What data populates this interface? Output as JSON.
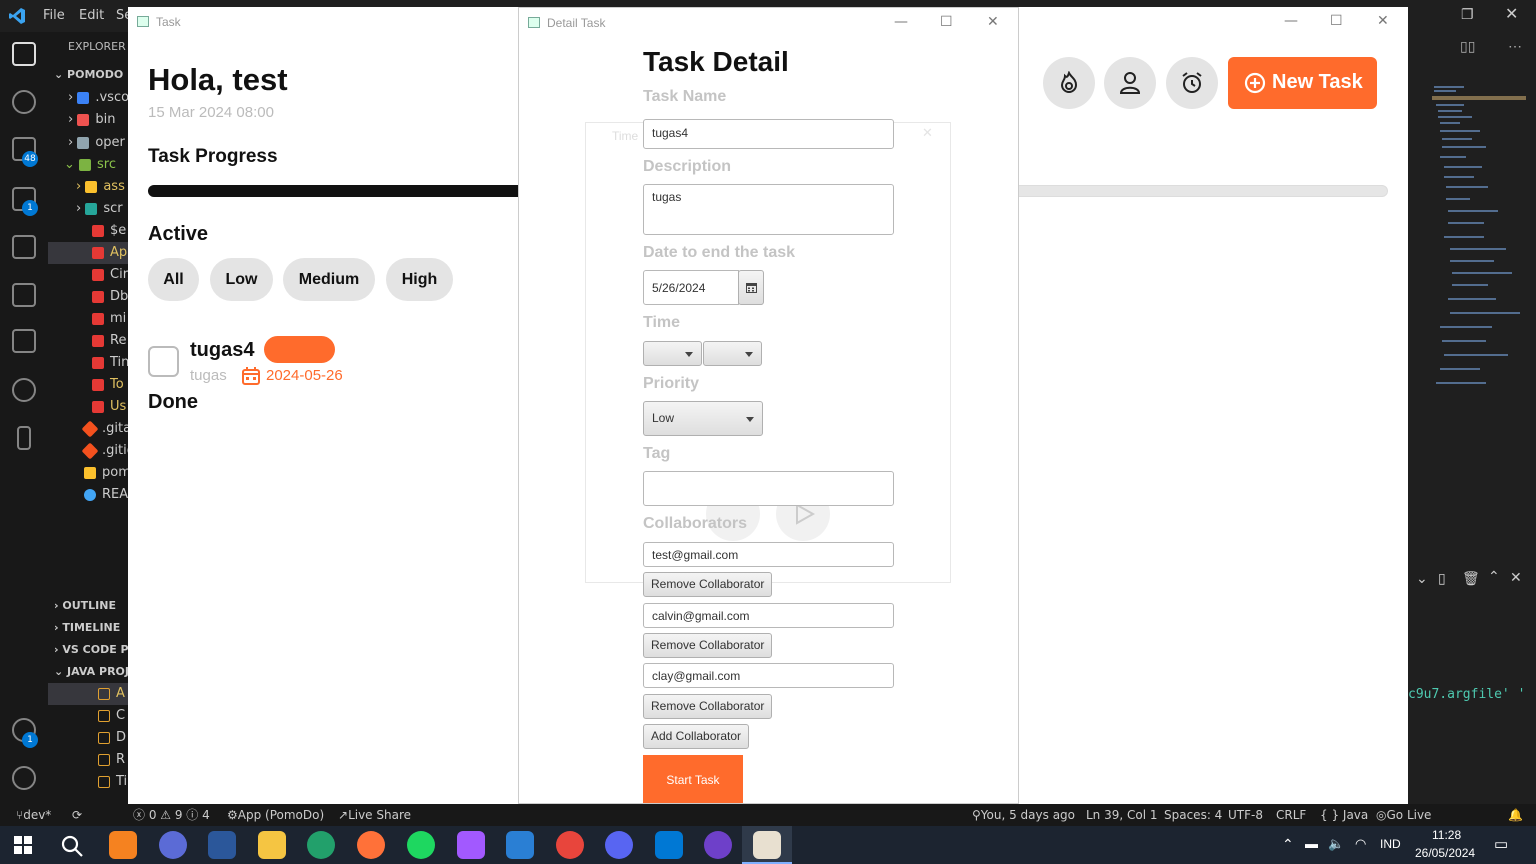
{
  "vscode": {
    "menu": [
      "File",
      "Edit",
      "Se"
    ],
    "activity_badges": [
      "48",
      "1",
      "1"
    ],
    "explorer_label": "EXPLORER",
    "project_label": "POMODO",
    "tree": [
      ".vsco",
      "bin",
      "oper",
      "src",
      "ass",
      "scr",
      "$e",
      "Ap",
      "Cir",
      "Db",
      "mi",
      "Re",
      "Tin",
      "To",
      "Us",
      ".gita",
      ".gitig",
      "pom",
      "REA"
    ],
    "sections": [
      "OUTLINE",
      "TIMELINE",
      "VS CODE PE",
      "JAVA PROJE"
    ],
    "java_items": [
      "A",
      "C",
      "D",
      "R",
      "Ti"
    ],
    "terminal_text": "c9u7.argfile' '",
    "status": {
      "branch": "dev*",
      "problems": "ⓧ 0 ⚠ 9 ⓘ 4",
      "run": "App (PomoDo)",
      "live_share": "Live Share",
      "blame": "You, 5 days ago",
      "position": "Ln 39, Col 1",
      "spaces": "Spaces: 4",
      "encoding": "UTF-8",
      "eol": "CRLF",
      "language": "{ } Java",
      "go_live": "Go Live"
    }
  },
  "task_window": {
    "title": "Task",
    "greeting": "Hola, test",
    "date": "15 Mar 2024 08:00",
    "progress_label": "Task Progress",
    "active_label": "Active",
    "filters": [
      "All",
      "Low",
      "Medium",
      "High"
    ],
    "task": {
      "name": "tugas4",
      "description": "tugas",
      "due": "2024-05-26"
    },
    "done_label": "Done",
    "new_task_label": "New Task"
  },
  "ghost_window": {
    "title": "Time"
  },
  "detail_window": {
    "title": "Detail Task",
    "heading": "Task Detail",
    "task_name_label": "Task Name",
    "task_name_value": "tugas4",
    "description_label": "Description",
    "description_value": "tugas",
    "date_label": "Date to end the task",
    "date_value": "5/26/2024",
    "time_label": "Time",
    "priority_label": "Priority",
    "priority_value": "Low",
    "tag_label": "Tag",
    "tag_value": "",
    "collaborators_label": "Collaborators",
    "collaborators": [
      "test@gmail.com",
      "calvin@gmail.com",
      "clay@gmail.com"
    ],
    "remove_label": "Remove Collaborator",
    "add_label": "Add Collaborator",
    "start_label": "Start Task"
  },
  "taskbar": {
    "language": "IND",
    "time": "11:28",
    "date": "26/05/2024"
  },
  "colors": {
    "accent": "#ff6b2c",
    "progress": "#111111",
    "chip": "#e4e4e4"
  }
}
